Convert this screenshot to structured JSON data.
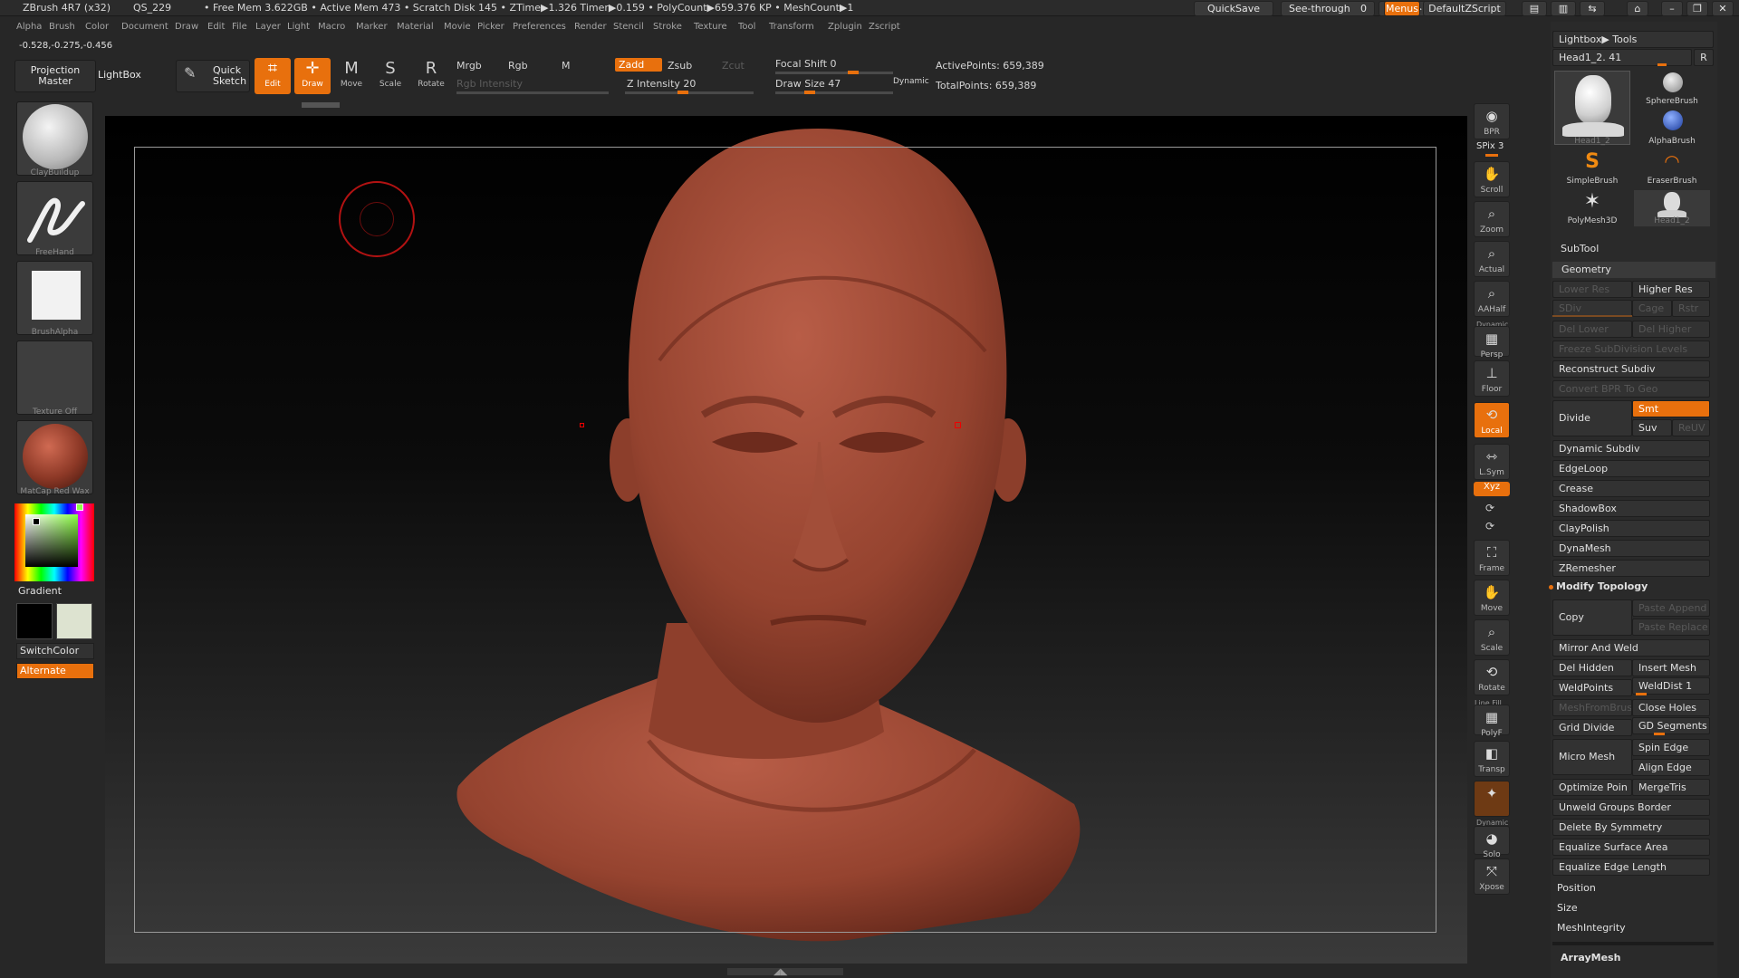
{
  "titlebar": {
    "app": "ZBrush 4R7 (x32)",
    "project": "QS_229",
    "stats": "• Free Mem 3.622GB • Active Mem 473 • Scratch Disk 145 • ZTime▶1.326 Timer▶0.159 • PolyCount▶659.376 KP • MeshCount▶1",
    "quicksave": "QuickSave",
    "seethrough": "See-through",
    "seethrough_value": "0",
    "menus": "Menus",
    "defaultzscript": "DefaultZScript"
  },
  "menubar": [
    "Alpha",
    "Brush",
    "Color",
    "Document",
    "Draw",
    "Edit",
    "File",
    "Layer",
    "Light",
    "Macro",
    "Marker",
    "Material",
    "Movie",
    "Picker",
    "Preferences",
    "Render",
    "Stencil",
    "Stroke",
    "Texture",
    "Tool",
    "Transform",
    "Zplugin",
    "Zscript"
  ],
  "coords": "-0.528,-0.275,-0.456",
  "shelf": {
    "projection_master": "Projection Master",
    "lightbox": "LightBox",
    "quick_sketch": "Quick Sketch",
    "tools": [
      {
        "label": "Edit",
        "icon": "edit-icon",
        "active": true
      },
      {
        "label": "Draw",
        "icon": "draw-icon",
        "active": true
      },
      {
        "label": "Move",
        "icon": "move-icon",
        "active": false
      },
      {
        "label": "Scale",
        "icon": "scale-icon",
        "active": false
      },
      {
        "label": "Rotate",
        "icon": "rotate-icon",
        "active": false
      }
    ],
    "mrgb": "Mrgb",
    "rgb": "Rgb",
    "m": "M",
    "rgb_intensity": "Rgb Intensity",
    "zadd": "Zadd",
    "zsub": "Zsub",
    "zcut": "Zcut",
    "z_intensity": "Z Intensity 20",
    "focal_shift": "Focal Shift 0",
    "draw_size": "Draw Size 47",
    "dynamic": "Dynamic",
    "active_points": "ActivePoints: 659,389",
    "total_points": "TotalPoints: 659,389"
  },
  "left_panel": {
    "brush": "ClayBuildup",
    "stroke": "FreeHand",
    "alpha": "BrushAlpha",
    "texture": "Texture Off",
    "material": "MatCap Red Wax",
    "gradient": "Gradient",
    "switchcolor": "SwitchColor",
    "alternate": "Alternate"
  },
  "nav": {
    "bpr": "BPR",
    "spix": "SPix 3",
    "buttons": [
      "Scroll",
      "Zoom",
      "Actual",
      "AAHalf",
      "Persp",
      "Floor",
      "Local",
      "L.Sym",
      "Xyz",
      "Frame",
      "Move",
      "Scale",
      "Rotate",
      "PolyF",
      "Transp",
      "Solo",
      "Xpose"
    ],
    "dynamic_label": "Dynamic",
    "line_fill": "Line Fill"
  },
  "toolpanel": {
    "lightbox_tools": "Lightbox▶ Tools",
    "r": "R",
    "current_tool": "Head1_2. 41",
    "tools": [
      "Head1_2",
      "SphereBrush",
      "AlphaBrush",
      "SimpleBrush",
      "EraserBrush",
      "PolyMesh3D",
      "Head1_2"
    ],
    "subtool": "SubTool",
    "geometry": "Geometry",
    "lower_res": "Lower Res",
    "higher_res": "Higher Res",
    "sdiv": "SDiv",
    "cage": "Cage",
    "rstr": "Rstr",
    "del_lower": "Del Lower",
    "del_higher": "Del Higher",
    "freeze": "Freeze SubDivision Levels",
    "reconstruct": "Reconstruct Subdiv",
    "convert_bpr": "Convert BPR To Geo",
    "divide": "Divide",
    "smt": "Smt",
    "suv": "Suv",
    "reuv": "ReUV",
    "dynamic_subdiv": "Dynamic Subdiv",
    "edgeloop": "EdgeLoop",
    "crease": "Crease",
    "shadowbox": "ShadowBox",
    "claypolish": "ClayPolish",
    "dynamesh": "DynaMesh",
    "zremesher": "ZRemesher",
    "modify_topology": "Modify Topology",
    "copy": "Copy",
    "paste_append": "Paste Append",
    "paste_replace": "Paste Replace",
    "mirror_weld": "Mirror And Weld",
    "del_hidden": "Del Hidden",
    "insert_mesh": "Insert Mesh",
    "weldpoints": "WeldPoints",
    "welddist": "WeldDist 1",
    "meshfrombrush": "MeshFromBrus",
    "close_holes": "Close Holes",
    "grid_divide": "Grid Divide",
    "gd_segments": "GD Segments",
    "micro_mesh": "Micro Mesh",
    "spin_edge": "Spin Edge",
    "align_edge": "Align Edge",
    "optimize_points": "Optimize Poin",
    "mergetris": "MergeTris",
    "unweld_groups": "Unweld Groups Border",
    "delete_symmetry": "Delete By Symmetry",
    "equalize_surface": "Equalize Surface Area",
    "equalize_edge": "Equalize Edge Length",
    "position": "Position",
    "size": "Size",
    "meshintegrity": "MeshIntegrity",
    "arraymesh": "ArrayMesh"
  },
  "colors": {
    "accent": "#e8700d",
    "clay": "#9c4a38"
  }
}
